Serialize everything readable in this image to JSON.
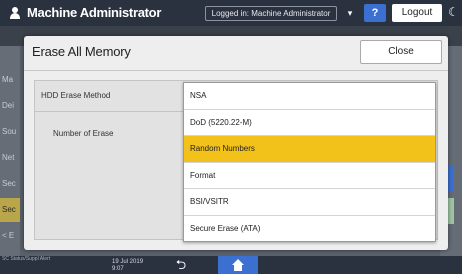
{
  "topbar": {
    "title": "Machine Administrator",
    "logged_in": "Logged in: Machine Administrator",
    "help_label": "?",
    "logout_label": "Logout"
  },
  "background": {
    "side_items": [
      "Ma",
      "Dei",
      "Sou",
      "Net",
      "Sec",
      "Sec",
      "< E"
    ],
    "selected_side_index": 5
  },
  "dialog": {
    "title": "Erase All Memory",
    "close_label": "Close",
    "settings": {
      "hdd_erase_method_label": "HDD Erase Method",
      "number_of_erase_label": "Number of Erase"
    },
    "options": [
      "NSA",
      "DoD (5220.22-M)",
      "Random Numbers",
      "Format",
      "BSI/VSITR",
      "Secure Erase (ATA)"
    ],
    "selected_option": "Random Numbers"
  },
  "bottombar": {
    "status": "SC Status/Suppl Alert",
    "date": "19 Jul 2019",
    "time": "9:07"
  },
  "colors": {
    "topbar": "#2a3240",
    "accent_blue": "#3b6fd0",
    "selected_option": "#f2c21b"
  },
  "icons": {
    "user": "user-icon",
    "dropdown": "chevron-down-icon",
    "moon": "moon-icon",
    "back": "back-arrow-icon",
    "home": "home-icon"
  }
}
